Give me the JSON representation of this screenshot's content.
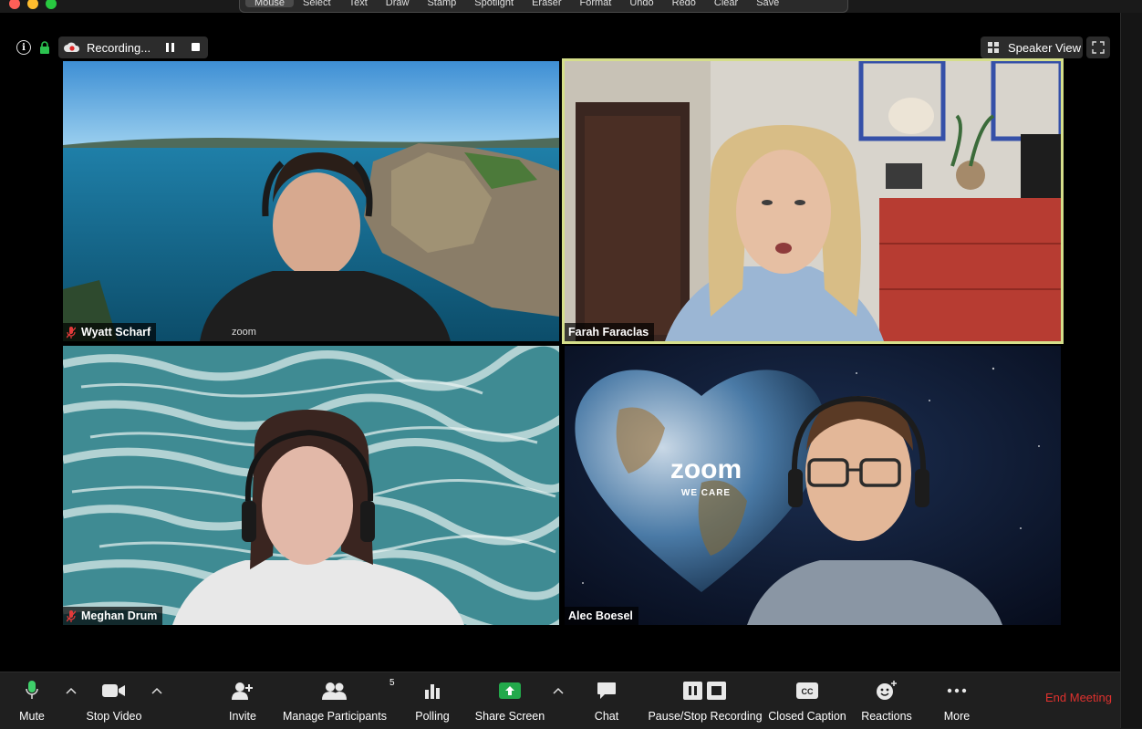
{
  "window": {
    "traffic_lights": [
      "#fe5f57",
      "#febc2e",
      "#28c840"
    ]
  },
  "annotation_toolbar": {
    "tools": [
      "Mouse",
      "Select",
      "Text",
      "Draw",
      "Stamp",
      "Spotlight",
      "Eraser",
      "Format",
      "Undo",
      "Redo",
      "Clear",
      "Save"
    ],
    "active": "Mouse"
  },
  "top_bar": {
    "recording_label": "Recording...",
    "speaker_view_label": "Speaker View"
  },
  "participants": [
    {
      "name": "Wyatt Scharf",
      "muted": true,
      "background": "sea-cliff"
    },
    {
      "name": "Farah Faraclas",
      "muted": false,
      "speaking": true,
      "background": "room"
    },
    {
      "name": "Meghan Drum",
      "muted": true,
      "background": "ocean-waves"
    },
    {
      "name": "Alec Boesel",
      "muted": false,
      "background": "zoom-we-care-heart",
      "background_text": {
        "logo": "zoom",
        "tagline": "WE CARE"
      }
    }
  ],
  "toolbar": {
    "mute_label": "Mute",
    "stop_video_label": "Stop Video",
    "invite_label": "Invite",
    "manage_participants_label": "Manage Participants",
    "participant_count": "5",
    "polling_label": "Polling",
    "share_screen_label": "Share Screen",
    "chat_label": "Chat",
    "pause_stop_recording_label": "Pause/Stop Recording",
    "closed_caption_label": "Closed Caption",
    "cc_text": "CC",
    "reactions_label": "Reactions",
    "more_label": "More",
    "end_meeting_label": "End Meeting"
  },
  "colors": {
    "accent_green": "#23a94b",
    "end_meeting_red": "#e0312e",
    "speaking_border": "#d5de8a",
    "mic_green": "#3fcf6a"
  }
}
